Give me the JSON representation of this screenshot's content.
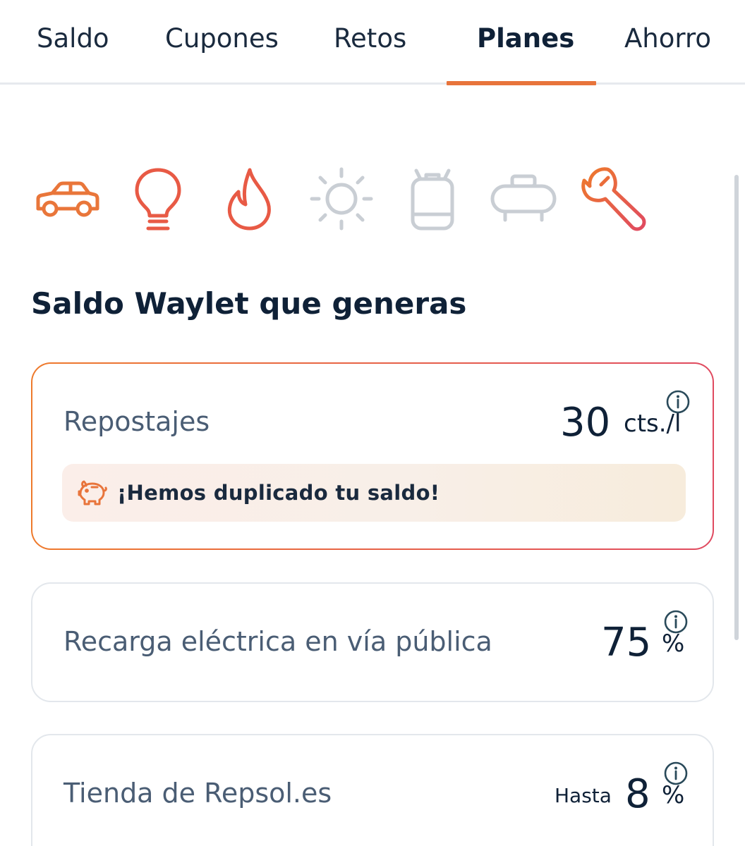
{
  "tabs": [
    {
      "label": "Saldo"
    },
    {
      "label": "Cupones"
    },
    {
      "label": "Retos"
    },
    {
      "label": "Planes",
      "active": true
    },
    {
      "label": "Ahorro"
    }
  ],
  "categories": [
    {
      "icon": "car-icon",
      "active": true
    },
    {
      "icon": "lightbulb-icon",
      "active": true
    },
    {
      "icon": "flame-icon",
      "active": true
    },
    {
      "icon": "sun-icon",
      "active": false
    },
    {
      "icon": "gas-cylinder-icon",
      "active": false
    },
    {
      "icon": "propane-tank-icon",
      "active": false
    },
    {
      "icon": "wrench-icon",
      "active": true
    }
  ],
  "colors": {
    "accent": "#e8743b",
    "gradient_start": "#ee7a2c",
    "gradient_end": "#e04a60",
    "inactive_icon": "#c9ced4",
    "text_primary": "#0f2137",
    "text_secondary": "#4a5d74"
  },
  "section": {
    "title": "Saldo Waylet que generas"
  },
  "cards": [
    {
      "label": "Repostajes",
      "value": "30",
      "unit": "cts./l",
      "promo": "¡Hemos duplicado tu saldo!"
    },
    {
      "label": "Recarga eléctrica en vía pública",
      "value": "75",
      "unit": "%"
    },
    {
      "label": "Tienda de Repsol.es",
      "prefix": "Hasta",
      "value": "8",
      "unit": "%"
    }
  ]
}
